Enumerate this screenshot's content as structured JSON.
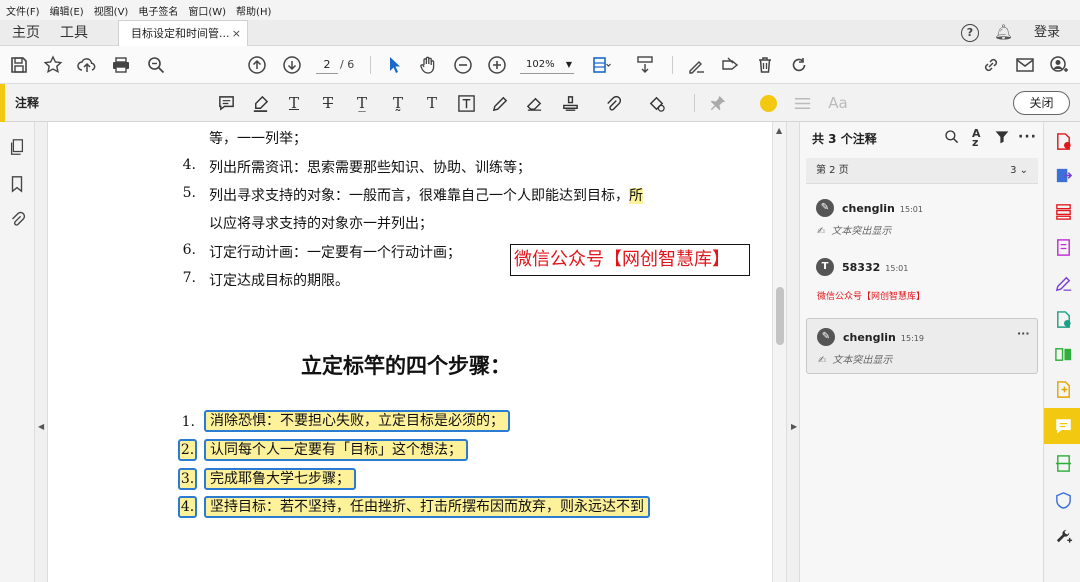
{
  "menu": [
    "文件(F)",
    "编辑(E)",
    "视图(V)",
    "电子签名",
    "窗口(W)",
    "帮助(H)"
  ],
  "tabs": {
    "home": "主页",
    "tools": "工具",
    "document": "目标设定和时间管...",
    "close": "×"
  },
  "account": {
    "login": "登录"
  },
  "page_nav": {
    "current": "2",
    "total": "/ 6"
  },
  "zoom": {
    "value": "102%"
  },
  "annotation_bar": {
    "label": "注释",
    "close": "关闭",
    "text_style": "Aa"
  },
  "document": {
    "lines": [
      {
        "num": "",
        "text": "等，一一列举；"
      },
      {
        "num": "4.",
        "text": "列出所需资讯：思索需要那些知识、协助、训练等；"
      },
      {
        "num": "5.",
        "text": "列出寻求支持的对象：一般而言，很难靠自己一个人即能达到目标，",
        "hl": "所"
      },
      {
        "num": "",
        "text": "以应将寻求支持的对象亦一并列出；"
      },
      {
        "num": "6.",
        "text": "订定行动计画：一定要有一个行动计画；"
      },
      {
        "num": "7.",
        "text": "订定达成目标的期限。"
      }
    ],
    "stamp": "微信公众号【网创智慧库】",
    "heading": "立定标竿的四个步骤：",
    "steps": [
      {
        "num": "1.",
        "text": "消除恐惧：不要担心失败，立定目标是必须的；"
      },
      {
        "num": "2.",
        "text": "认同每个人一定要有「目标」这个想法；"
      },
      {
        "num": "3.",
        "text": "完成耶鲁大学七步骤；"
      },
      {
        "num": "4.",
        "text": "坚持目标：若不坚持，任由挫折、打击所摆布因而放弃，则永远达不到"
      }
    ]
  },
  "comments_panel": {
    "title": "共 3 个注释",
    "page_group": "第 2 页",
    "page_count": "3",
    "items": [
      {
        "author": "chenglin",
        "time": "15:01",
        "desc": "文本突出显示",
        "avatar": "pen"
      },
      {
        "author": "58332",
        "time": "15:01",
        "text": "微信公众号【网创智慧库】",
        "avatar": "T"
      },
      {
        "author": "chenglin",
        "time": "15:19",
        "desc": "文本突出显示",
        "avatar": "pen",
        "more": "···"
      }
    ]
  },
  "colors": {
    "accent_yellow": "#f2c811",
    "highlight": "#fdf19a",
    "selection_blue": "#2a7bd1",
    "stamp_red": "#e0161c"
  },
  "icons": {
    "toolbar": [
      "save-icon",
      "bookmark-star-icon",
      "upload-icon",
      "print-icon",
      "search-zoom-icon",
      "page-up-icon",
      "page-down-icon",
      "select-cursor-icon",
      "hand-icon",
      "zoom-out-icon",
      "zoom-in-icon",
      "fit-page-icon",
      "scroll-mode-icon",
      "sign-icon",
      "edit-icon",
      "delete-icon",
      "rotate-icon",
      "link-icon",
      "mail-icon",
      "share-user-icon"
    ],
    "annotation": [
      "comment-icon",
      "highlight-icon",
      "underline-icon",
      "strikethrough-icon",
      "replace-text-icon",
      "insert-text-icon",
      "add-text-icon",
      "text-box-icon",
      "pencil-icon",
      "eraser-icon",
      "stamp-icon",
      "attach-icon",
      "shapes-icon",
      "pin-icon",
      "color-circle-icon",
      "line-weight-icon"
    ]
  }
}
